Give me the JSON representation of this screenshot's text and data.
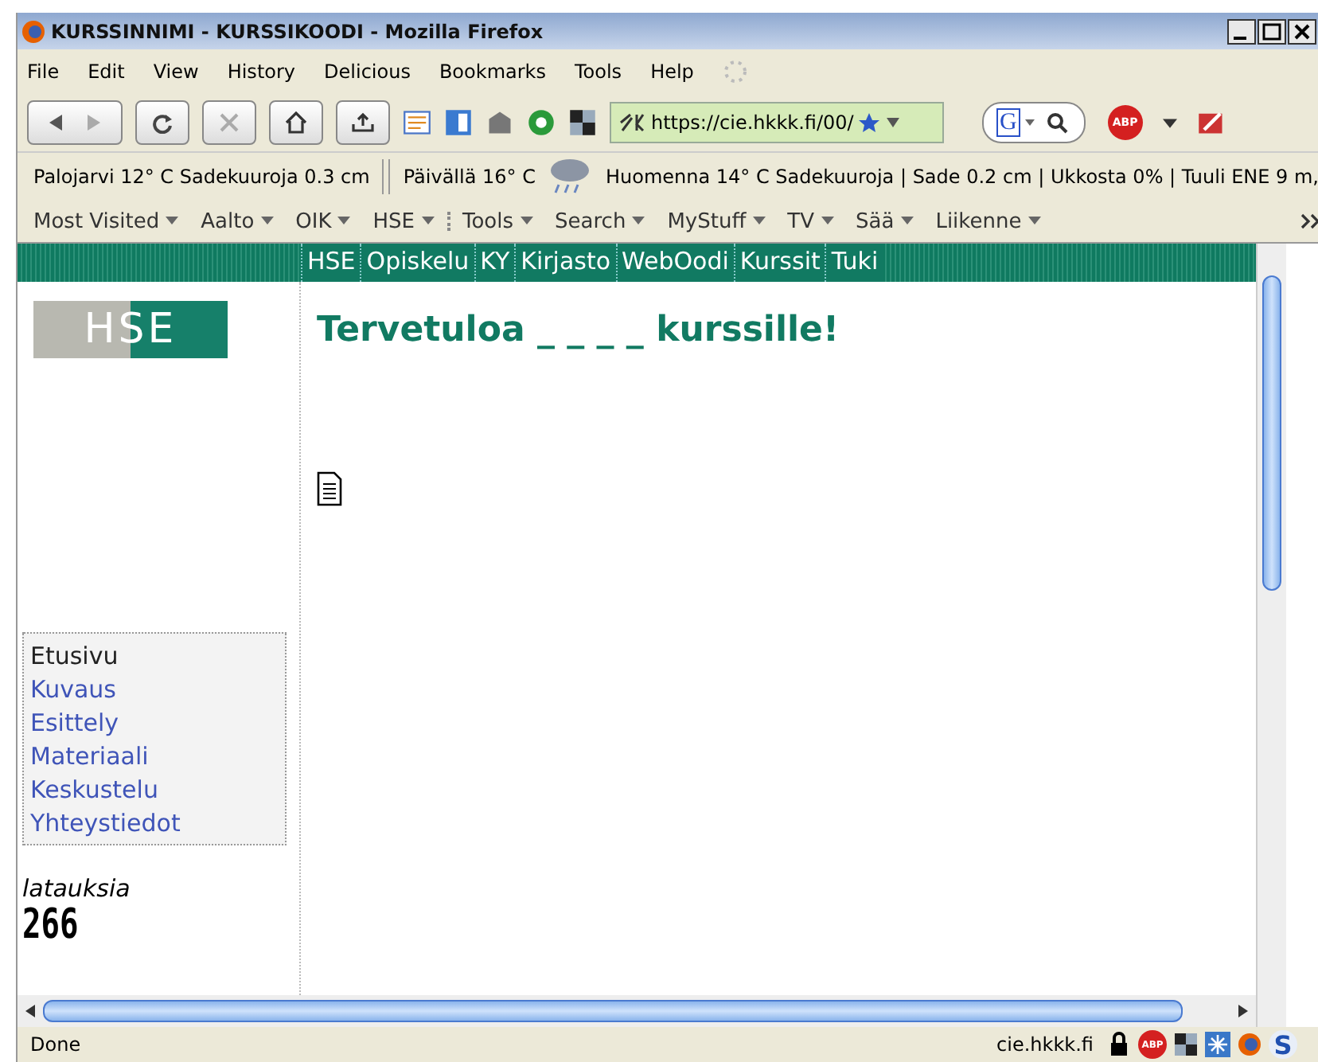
{
  "window": {
    "title": "KURSSINNIMI - KURSSIKOODI - Mozilla Firefox"
  },
  "menu": [
    "File",
    "Edit",
    "View",
    "History",
    "Delicious",
    "Bookmarks",
    "Tools",
    "Help"
  ],
  "toolbar": {
    "url": "https://cie.hkkk.fi/00/",
    "search_engine": "G",
    "abp_badge": "ABP"
  },
  "weather": [
    "Palojarvi 12° C Sadekuuroja 0.3 cm",
    "Päivällä 16° C",
    "Huomenna 14° C Sadekuuroja | Sade 0.2 cm | Ukkosta 0% | Tuuli ENE 9 m,"
  ],
  "bookmarks": [
    "Most Visited",
    "Aalto",
    "OIK",
    "HSE",
    "Tools",
    "Search",
    "MyStuff",
    "TV",
    "Sää",
    "Liikenne"
  ],
  "site_nav": [
    "HSE",
    "Opiskelu",
    "KY",
    "Kirjasto",
    "WebOodi",
    "Kurssit",
    "Tuki"
  ],
  "logo": "HSE",
  "heading": "Tervetuloa _ _ _ _ kurssille!",
  "sidebar": [
    {
      "label": "Etusivu",
      "selected": true
    },
    {
      "label": "Kuvaus",
      "selected": false
    },
    {
      "label": "Esittely",
      "selected": false
    },
    {
      "label": "Materiaali",
      "selected": false
    },
    {
      "label": "Keskustelu",
      "selected": false
    },
    {
      "label": "Yhteystiedot",
      "selected": false
    }
  ],
  "counter": {
    "label": "latauksia",
    "value": "266"
  },
  "status_bar": {
    "text": "Done",
    "domain": "cie.hkkk.fi",
    "abp_badge": "ABP",
    "s_badge": "S"
  }
}
